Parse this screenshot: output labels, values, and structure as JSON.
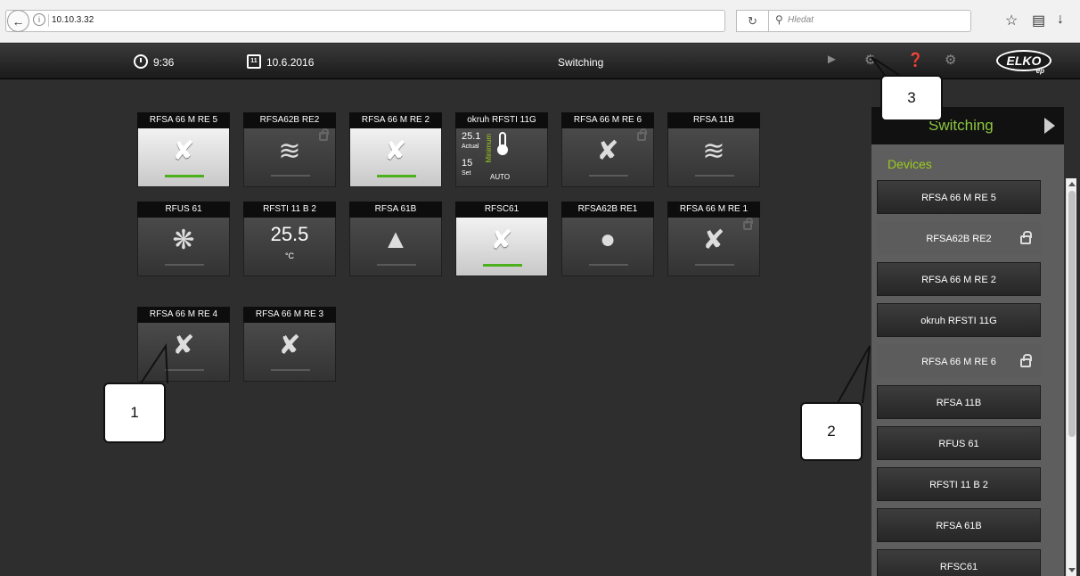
{
  "browser": {
    "url": "10.10.3.32",
    "search_placeholder": "Hledat"
  },
  "header": {
    "time": "9:36",
    "date": "10.6.2016",
    "title": "Switching",
    "logo": "ELKO ep"
  },
  "tiles": [
    {
      "name": "RFSA 66 M RE 5",
      "icon": "plug-icon",
      "active": true
    },
    {
      "name": "RFSA62B RE2",
      "icon": "waves-icon",
      "active": false,
      "locked": true
    },
    {
      "name": "RFSA 66 M RE 2",
      "icon": "plug-icon",
      "active": true
    },
    {
      "name": "okruh RFSTI 11G",
      "icon": "thermometer-icon",
      "actual_value": "25.1",
      "actual_label": "Actual",
      "set_value": "15",
      "set_label": "Set",
      "mode_label": "Minimum",
      "auto_label": "AUTO"
    },
    {
      "name": "RFSA 66 M RE 6",
      "icon": "plug-icon",
      "active": false,
      "locked": true
    },
    {
      "name": "RFSA 11B",
      "icon": "waves-icon",
      "active": false
    },
    {
      "name": "RFUS 61",
      "icon": "fan-icon",
      "active": false
    },
    {
      "name": "RFSTI 11 B 2",
      "icon": "temperature-readout",
      "temperature": "25.5",
      "unit": "°C"
    },
    {
      "name": "RFSA 61B",
      "icon": "lamp-icon",
      "active": false
    },
    {
      "name": "RFSC61",
      "icon": "plug-icon",
      "active": true
    },
    {
      "name": "RFSA62B RE1",
      "icon": "bulb-icon",
      "active": false
    },
    {
      "name": "RFSA 66 M RE 1",
      "icon": "plug-icon",
      "active": false,
      "locked": true
    },
    {
      "name": "RFSA 66 M RE 4",
      "icon": "plug-icon",
      "active": false
    },
    {
      "name": "RFSA 66 M RE 3",
      "icon": "plug-icon",
      "active": false
    }
  ],
  "callouts": [
    "1",
    "2",
    "3"
  ],
  "side_panel": {
    "title": "Switching",
    "devices_label": "Devices",
    "devices": [
      {
        "name": "RFSA 66 M RE 5",
        "locked": false
      },
      {
        "name": "RFSA62B RE2",
        "locked": true
      },
      {
        "name": "RFSA 66 M RE 2",
        "locked": false
      },
      {
        "name": "okruh RFSTI 11G",
        "locked": false
      },
      {
        "name": "RFSA 66 M RE 6",
        "locked": true
      },
      {
        "name": "RFSA 11B",
        "locked": false
      },
      {
        "name": "RFUS 61",
        "locked": false
      },
      {
        "name": "RFSTI 11 B 2",
        "locked": false
      },
      {
        "name": "RFSA 61B",
        "locked": false
      },
      {
        "name": "RFSC61",
        "locked": false
      }
    ]
  }
}
